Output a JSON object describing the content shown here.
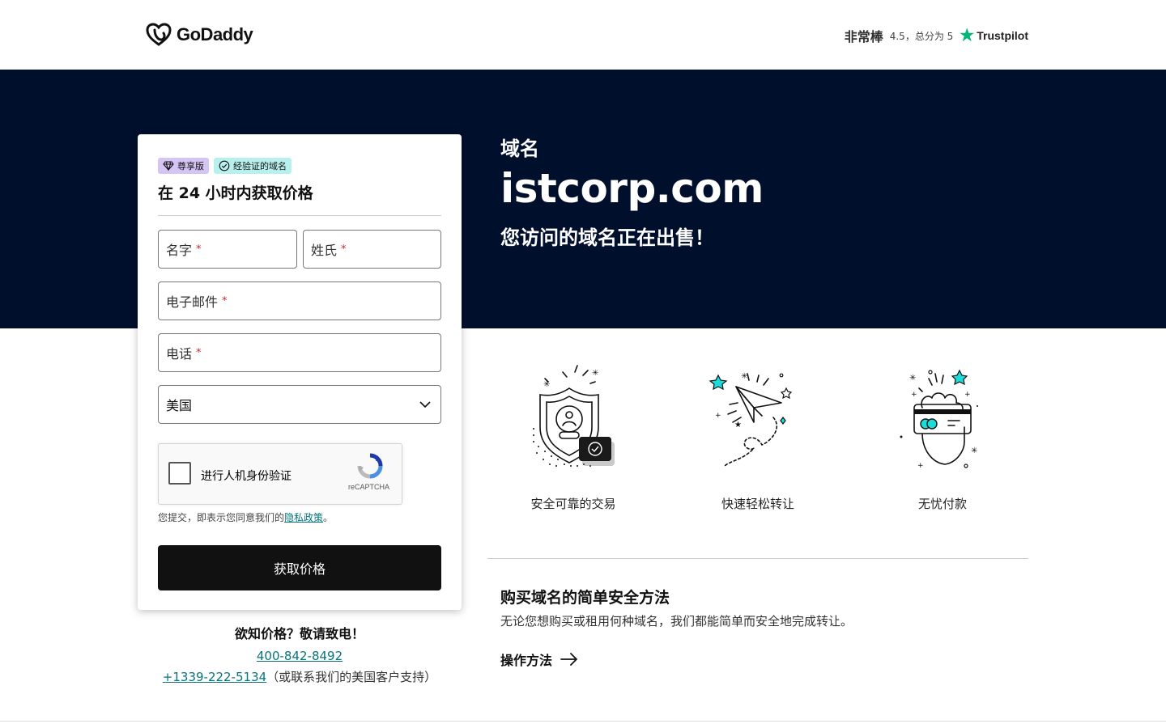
{
  "header": {
    "logo_text": "GoDaddy",
    "rating_word": "非常棒",
    "rating_score": "4.5，总分为 5",
    "trustpilot": "Trustpilot"
  },
  "hero": {
    "label": "域名",
    "domain": "istcorp.com",
    "subtitle": "您访问的域名正在出售！"
  },
  "form": {
    "badge_premium": "尊享版",
    "badge_verified": "经验证的域名",
    "title": "在 24 小时内获取价格",
    "first_name": "名字",
    "last_name": "姓氏",
    "email": "电子邮件",
    "phone": "电话",
    "required_mark": "*",
    "country": "美国",
    "captcha_label": "进行人机身份验证",
    "captcha_brand": "reCAPTCHA",
    "consent_text": "您提交，即表示您同意我们的",
    "privacy_link": "隐私政策",
    "consent_end": "。",
    "submit_label": "获取价格"
  },
  "call": {
    "title": "欲知价格？敬请致电！",
    "phone": "400-842-8492",
    "intl_phone": "+1339-222-5134",
    "intl_note": "（或联系我们的美国客户支持）"
  },
  "features": [
    {
      "label": "安全可靠的交易",
      "icon": "shield-icon"
    },
    {
      "label": "快速轻松转让",
      "icon": "paper-plane-icon"
    },
    {
      "label": "无忧付款",
      "icon": "credit-card-icon"
    }
  ],
  "info": {
    "title": "购买域名的简单安全方法",
    "text": "无论您想购买或租用何种域名，我们都能简单而安全地完成转让。",
    "howto_label": "操作方法"
  },
  "colors": {
    "hero_bg": "#000f2c",
    "link": "#08737a",
    "trustpilot_star": "#00b67a",
    "accent_teal": "#1bdbdb"
  }
}
